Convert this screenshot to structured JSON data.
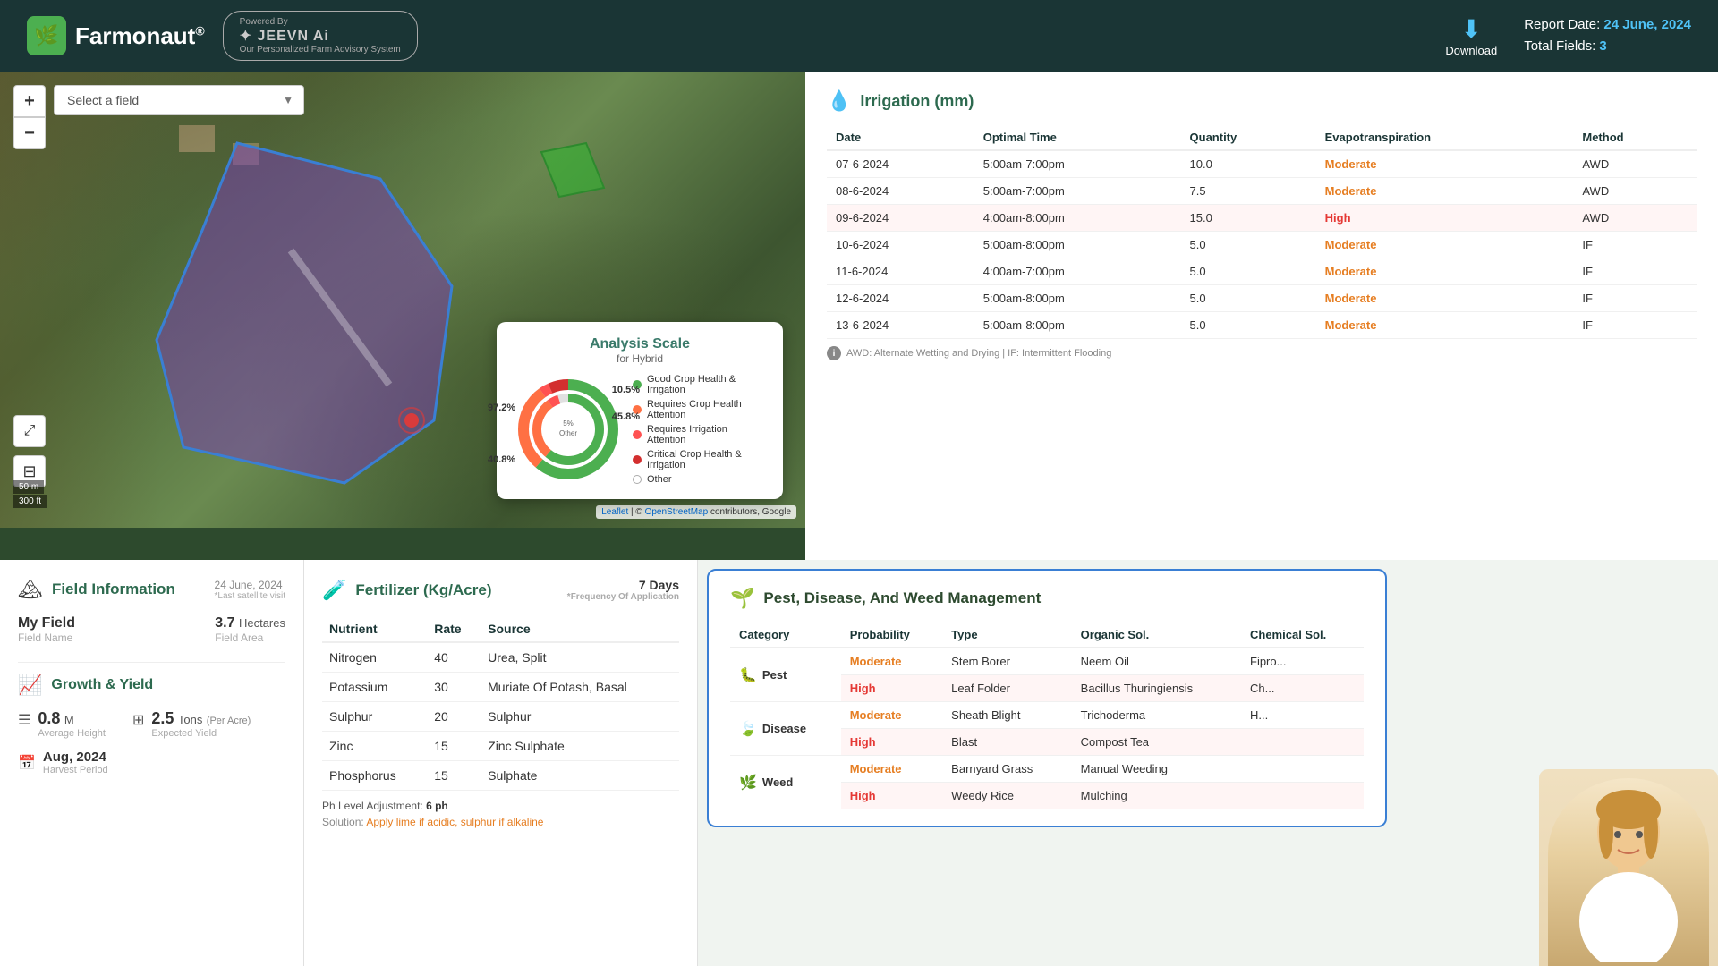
{
  "header": {
    "logo_text": "Farmonaut",
    "logo_reg": "®",
    "jeevn_title": "JEEVN Ai",
    "jeevn_powered": "Powered By",
    "jeevn_sub": "Our Personalized Farm Advisory System",
    "download_label": "Download",
    "report_date_label": "Report Date:",
    "report_date": "24 June, 2024",
    "total_fields_label": "Total Fields:",
    "total_fields": "3"
  },
  "map": {
    "select_placeholder": "Select a field",
    "zoom_in": "+",
    "zoom_out": "−",
    "scale_m": "50 m",
    "scale_ft": "300 ft",
    "attribution": "Leaflet | © OpenStreetMap contributors, Google"
  },
  "analysis_scale": {
    "title": "Analysis Scale",
    "subtitle": "for Hybrid",
    "pct_97": "97.2%",
    "pct_10": "10.5%",
    "pct_45": "45.8%",
    "pct_5": "5%",
    "pct_other_label": "Other",
    "pct_40": "40.8%",
    "legend": [
      {
        "label": "Good Crop Health & Irrigation",
        "color": "#4CAF50"
      },
      {
        "label": "Requires Crop Health Attention",
        "color": "#FF7043"
      },
      {
        "label": "Requires Irrigation Attention",
        "color": "#FF5252"
      },
      {
        "label": "Critical Crop Health & Irrigation",
        "color": "#D32F2F"
      },
      {
        "label": "Other",
        "color": "#e0e0e0",
        "ring": true
      }
    ]
  },
  "field_info": {
    "section_title": "Field Information",
    "date": "24 June, 2024",
    "date_sub": "*Last satellite visit",
    "field_name_label": "Field Name",
    "field_name": "My Field",
    "field_area_label": "Field Area",
    "field_area": "3.7",
    "field_area_unit": "Hectares",
    "growth_title": "Growth & Yield",
    "avg_height_val": "0.8",
    "avg_height_unit": "M",
    "avg_height_label": "Average Height",
    "expected_yield_val": "2.5",
    "expected_yield_unit": "Tons",
    "expected_yield_per": "(Per Acre)",
    "expected_yield_label": "Expected Yield",
    "harvest_val": "Aug, 2024",
    "harvest_label": "Harvest Period"
  },
  "fertilizer": {
    "section_title": "Fertilizer (Kg/Acre)",
    "frequency": "7 Days",
    "frequency_label": "*Frequency Of Application",
    "columns": [
      "Nutrient",
      "Rate",
      "Source"
    ],
    "rows": [
      {
        "nutrient": "Nitrogen",
        "rate": "40",
        "source": "Urea, Split"
      },
      {
        "nutrient": "Potassium",
        "rate": "30",
        "source": "Muriate Of Potash, Basal"
      },
      {
        "nutrient": "Sulphur",
        "rate": "20",
        "source": "Sulphur"
      },
      {
        "nutrient": "Zinc",
        "rate": "15",
        "source": "Zinc Sulphate"
      },
      {
        "nutrient": "Phosphorus",
        "rate": "15",
        "source": "Sulphate"
      }
    ],
    "ph_label": "Ph Level Adjustment:",
    "ph_val": "6 ph",
    "solution_label": "Solution:",
    "solution_text": "Apply lime if acidic, sulphur if alkaline"
  },
  "irrigation": {
    "section_title": "Irrigation (mm)",
    "columns": [
      "Date",
      "Optimal Time",
      "Quantity",
      "Evapotranspiration",
      "Method"
    ],
    "rows": [
      {
        "date": "07-6-2024",
        "time": "5:00am-7:00pm",
        "qty": "10.0",
        "evap": "Moderate",
        "method": "AWD",
        "highlight": false
      },
      {
        "date": "08-6-2024",
        "time": "5:00am-7:00pm",
        "qty": "7.5",
        "evap": "Moderate",
        "method": "AWD",
        "highlight": false
      },
      {
        "date": "09-6-2024",
        "time": "4:00am-8:00pm",
        "qty": "15.0",
        "evap": "High",
        "method": "AWD",
        "highlight": true
      },
      {
        "date": "10-6-2024",
        "time": "5:00am-8:00pm",
        "qty": "5.0",
        "evap": "Moderate",
        "method": "IF",
        "highlight": false
      },
      {
        "date": "11-6-2024",
        "time": "4:00am-7:00pm",
        "qty": "5.0",
        "evap": "Moderate",
        "method": "IF",
        "highlight": false
      },
      {
        "date": "12-6-2024",
        "time": "5:00am-8:00pm",
        "qty": "5.0",
        "evap": "Moderate",
        "method": "IF",
        "highlight": false
      },
      {
        "date": "13-6-2024",
        "time": "5:00am-8:00pm",
        "qty": "5.0",
        "evap": "Moderate",
        "method": "IF",
        "highlight": false
      }
    ],
    "note": "AWD: Alternate Wetting and Drying | IF: Intermittent Flooding"
  },
  "pest": {
    "section_title": "Pest, Disease, And Weed Management",
    "columns": [
      "Category",
      "Probability",
      "Type",
      "Organic Sol.",
      "Chemical Sol."
    ],
    "categories": [
      {
        "name": "Pest",
        "icon": "🐛",
        "rows": [
          {
            "prob": "Moderate",
            "prob_color": "orange",
            "type": "Stem Borer",
            "organic": "Neem Oil",
            "chemical": "Fipro...",
            "highlight": false
          },
          {
            "prob": "High",
            "prob_color": "red",
            "type": "Leaf Folder",
            "organic": "Bacillus Thuringiensis",
            "chemical": "Ch...",
            "highlight": true
          }
        ]
      },
      {
        "name": "Disease",
        "icon": "🍃",
        "rows": [
          {
            "prob": "Moderate",
            "prob_color": "orange",
            "type": "Sheath Blight",
            "organic": "Trichoderma",
            "chemical": "H...",
            "highlight": false
          },
          {
            "prob": "High",
            "prob_color": "red",
            "type": "Blast",
            "organic": "Compost Tea",
            "chemical": "",
            "highlight": true
          }
        ]
      },
      {
        "name": "Weed",
        "icon": "🌿",
        "rows": [
          {
            "prob": "Moderate",
            "prob_color": "orange",
            "type": "Barnyard Grass",
            "organic": "Manual Weeding",
            "chemical": "",
            "highlight": false
          },
          {
            "prob": "High",
            "prob_color": "red",
            "type": "Weedy Rice",
            "organic": "Mulching",
            "chemical": "",
            "highlight": true
          }
        ]
      }
    ]
  }
}
